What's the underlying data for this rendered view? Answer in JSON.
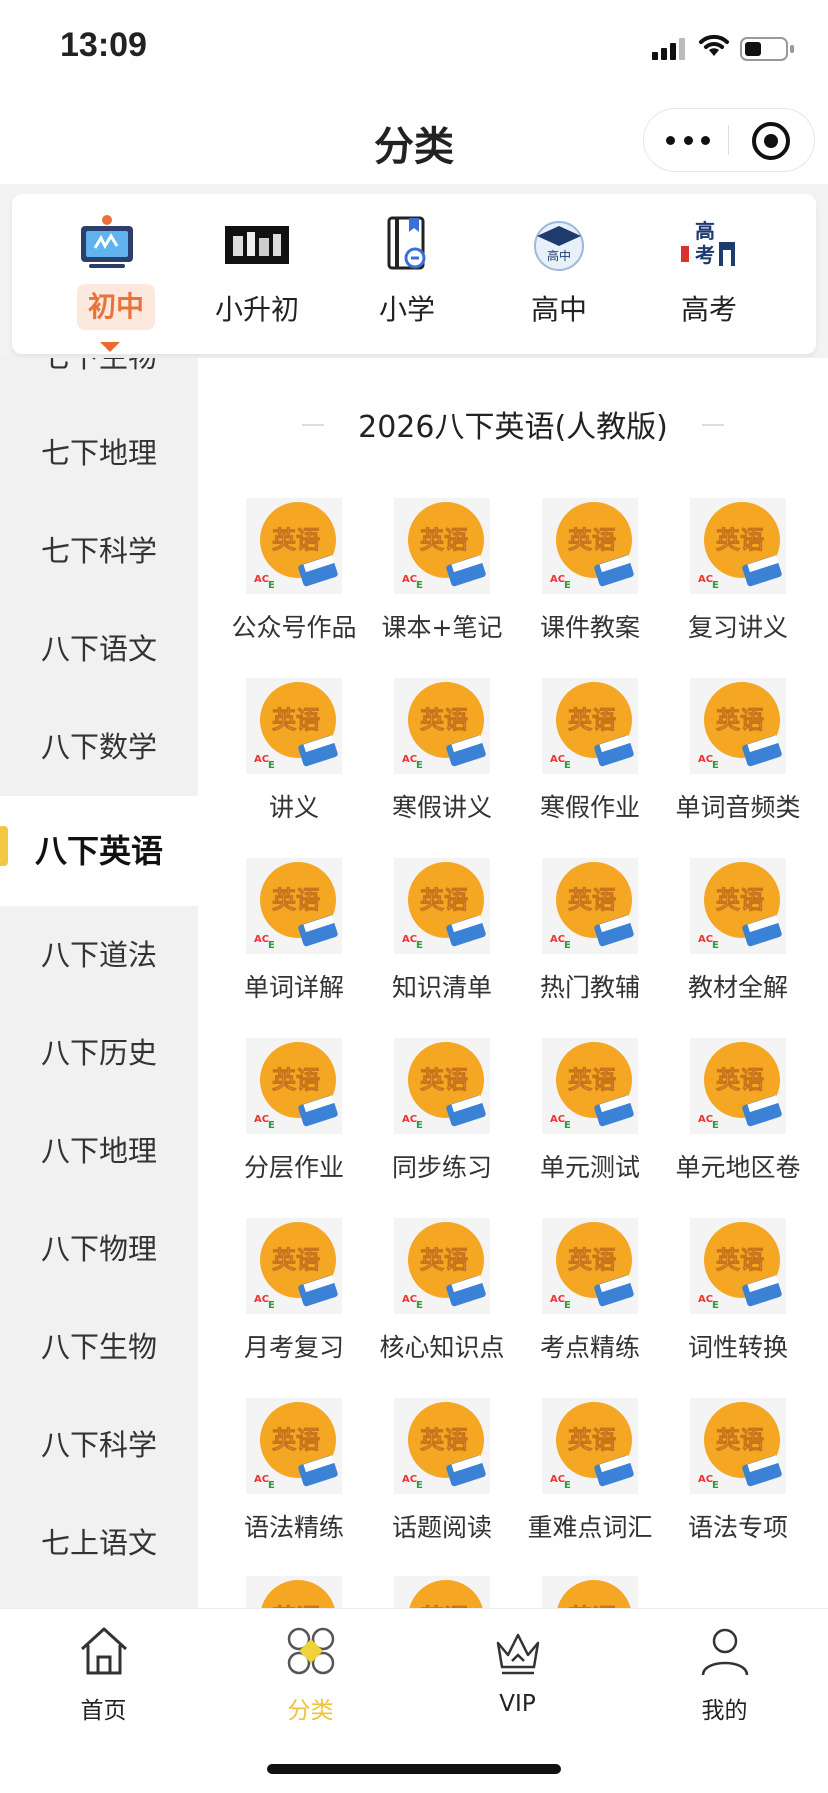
{
  "status_bar": {
    "time": "13:09"
  },
  "header": {
    "title": "分类"
  },
  "top_categories": [
    {
      "label": "初中",
      "icon": "whiteboard-icon",
      "active": true
    },
    {
      "label": "小升初",
      "icon": "banner-image-icon"
    },
    {
      "label": "小学",
      "icon": "book-link-icon"
    },
    {
      "label": "高中",
      "icon": "graduation-cap-icon"
    },
    {
      "label": "高考",
      "icon": "exam-gate-icon"
    }
  ],
  "sidebar": {
    "items": [
      "七下生物",
      "七下地理",
      "七下科学",
      "八下语文",
      "八下数学",
      "八下英语",
      "八下道法",
      "八下历史",
      "八下地理",
      "八下物理",
      "八下生物",
      "八下科学",
      "七上语文"
    ],
    "active": "八下英语"
  },
  "section": {
    "title": "2026八下英语(人教版)",
    "tile_icon_text": "英语",
    "items": [
      "公众号作品",
      "课本+笔记",
      "课件教案",
      "复习讲义",
      "讲义",
      "寒假讲义",
      "寒假作业",
      "单词音频类",
      "单词详解",
      "知识清单",
      "热门教辅",
      "教材全解",
      "分层作业",
      "同步练习",
      "单元测试",
      "单元地区卷",
      "月考复习",
      "核心知识点",
      "考点精练",
      "词性转换",
      "语法精练",
      "话题阅读",
      "重难点词汇",
      "语法专项",
      "",
      "",
      ""
    ]
  },
  "tabbar": {
    "items": [
      {
        "label": "首页",
        "icon": "home-icon"
      },
      {
        "label": "分类",
        "icon": "category-icon",
        "active": true
      },
      {
        "label": "VIP",
        "icon": "crown-icon"
      },
      {
        "label": "我的",
        "icon": "user-icon"
      }
    ]
  },
  "colors": {
    "accent_orange": "#ec6b2c",
    "accent_yellow": "#f5c842",
    "tile_orange": "#f5a623"
  }
}
